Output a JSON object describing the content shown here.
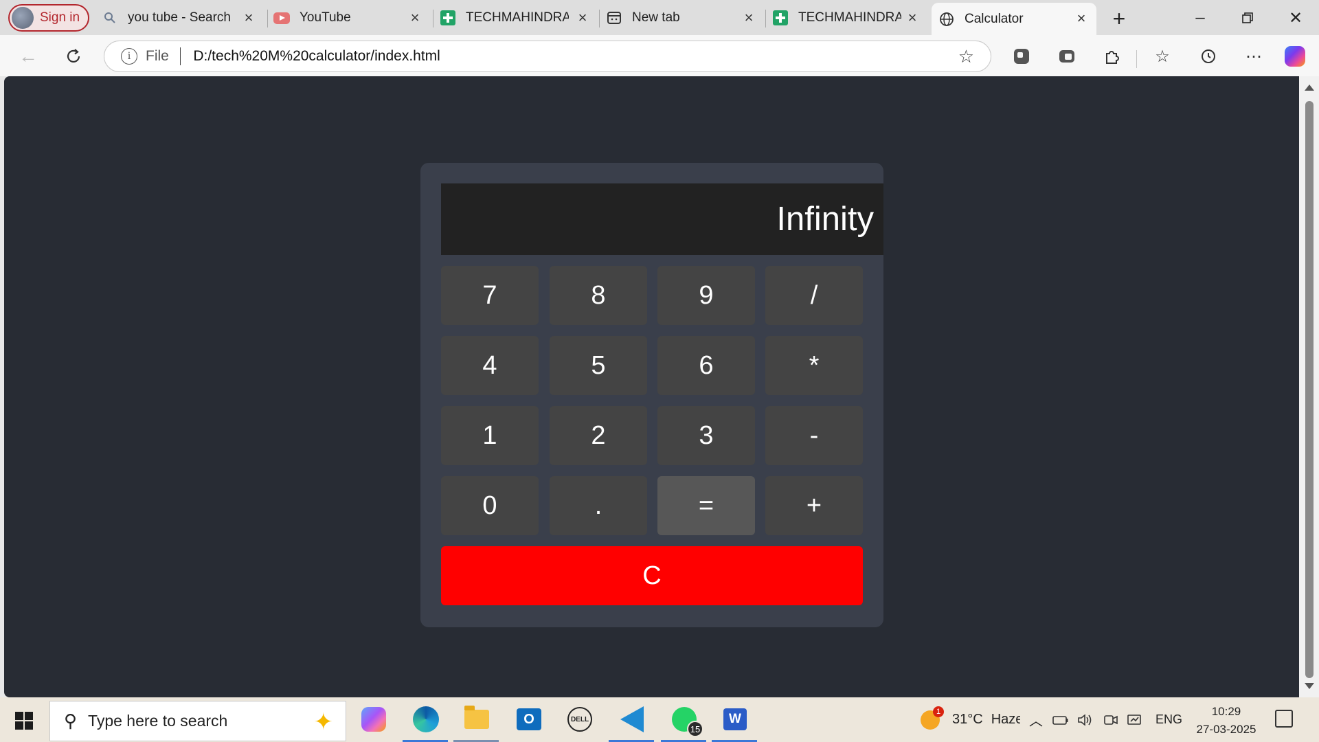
{
  "browser": {
    "sign_in_label": "Sign in",
    "tabs": [
      {
        "title": "you tube - Search",
        "icon": "search-icon"
      },
      {
        "title": "YouTube",
        "icon": "youtube-icon"
      },
      {
        "title": "TECHMAHINDRA C",
        "icon": "sheets-icon"
      },
      {
        "title": "New tab",
        "icon": "newtab-icon"
      },
      {
        "title": "TECHMAHINDRA C",
        "icon": "sheets-icon"
      },
      {
        "title": "Calculator",
        "icon": "globe-icon",
        "active": true
      }
    ],
    "address": {
      "scheme_label": "File",
      "url": "D:/tech%20M%20calculator/index.html"
    }
  },
  "calculator": {
    "display": "Infinity",
    "keys": [
      [
        "7",
        "8",
        "9",
        "/"
      ],
      [
        "4",
        "5",
        "6",
        "*"
      ],
      [
        "1",
        "2",
        "3",
        "-"
      ],
      [
        "0",
        ".",
        "=",
        "+"
      ]
    ],
    "clear_label": "C",
    "colors": {
      "page_bg": "#282c34",
      "panel_bg": "#3a3f4b",
      "display_bg": "#222222",
      "key_bg": "#444444",
      "equals_bg": "#575757",
      "clear_bg": "#ff0000"
    }
  },
  "taskbar": {
    "search_placeholder": "Type here to search",
    "whatsapp_badge": "15",
    "weather_badge": "1",
    "weather_text": "31°C",
    "weather_desc": "Haze",
    "language": "ENG",
    "time": "10:29",
    "date": "27-03-2025"
  }
}
